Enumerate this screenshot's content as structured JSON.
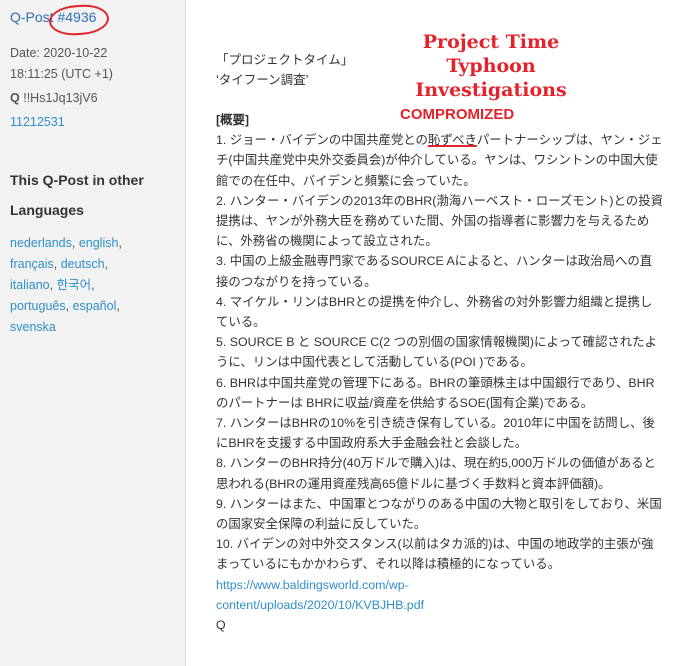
{
  "sidebar": {
    "post_prefix": "Q-Post",
    "post_number": "#4936",
    "date": "Date: 2020-10-22",
    "time": "18:11:25 (UTC +1)",
    "trip_label": "Q",
    "tripcode": "!!Hs1Jq13jV6",
    "post_id": "11212531",
    "languages_heading_line1": "This Q-Post in other",
    "languages_heading_line2": "Languages",
    "languages": [
      "nederlands",
      "english",
      "français",
      "deutsch",
      "italiano",
      "한국어",
      "português",
      "español",
      "svenska"
    ]
  },
  "annotation": {
    "title_line1": "Project Time",
    "title_line2": "Typhoon Investigations",
    "compromized": "COMPROMIZED",
    "color": "#e3232c"
  },
  "post": {
    "jp_line1": "「プロジェクトタイム」",
    "jp_line2": "‘タイフーン調査’",
    "section": "[概要]",
    "item1_pre": "1. ジョー・バイデンの中国共産党との",
    "item1_underlined": "恥ずべき",
    "item1_post": "パートナーシップは、ヤン・ジェチ(中国共産党中央外交委員会)が仲介している。ヤンは、ワシントンの中国大使館での在任中、バイデンと頻繁に会っていた。",
    "items": [
      "2. ハンター・バイデンの2013年のBHR(渤海ハーベスト・ローズモント)との投資提携は、ヤンが外務大臣を務めていた間、外国の指導者に影響力を与えるために、外務省の機関によって設立された。",
      "3. 中国の上級金融専門家であるSOURCE Aによると、ハンターは政治局への直接のつながりを持っている。",
      "4. マイケル・リンはBHRとの提携を仲介し、外務省の対外影響力組織と提携している。",
      "5. SOURCE B と SOURCE C(2 つの別個の国家情報機関)によって確認されたように、リンは中国代表として活動している(POI )である。",
      "6. BHRは中国共産党の管理下にある。BHRの筆頭株主は中国銀行であり、BHRのパートナーは BHRに収益/資産を供給するSOE(国有企業)である。",
      "7. ハンターはBHRの10%を引き続き保有している。2010年に中国を訪問し、後にBHRを支援する中国政府系大手金融会社と会談した。",
      "8. ハンターのBHR持分(40万ドルで購入)は、現在約5,000万ドルの価値があると思われる(BHRの運用資産残高65億ドルに基づく手数料と資本評価額)。",
      "9. ハンターはまた、中国軍とつながりのある中国の大物と取引をしており、米国の国家安全保障の利益に反していた。",
      "10. バイデンの対中外交スタンス(以前はタカ派的)は、中国の地政学的主張が強まっているにもかかわらず、それ以降は積極的になっている。"
    ],
    "link_line1": "https://www.baldingsworld.com/wp-",
    "link_line2": "content/uploads/2020/10/KVBJHB.pdf",
    "signature": "Q"
  }
}
